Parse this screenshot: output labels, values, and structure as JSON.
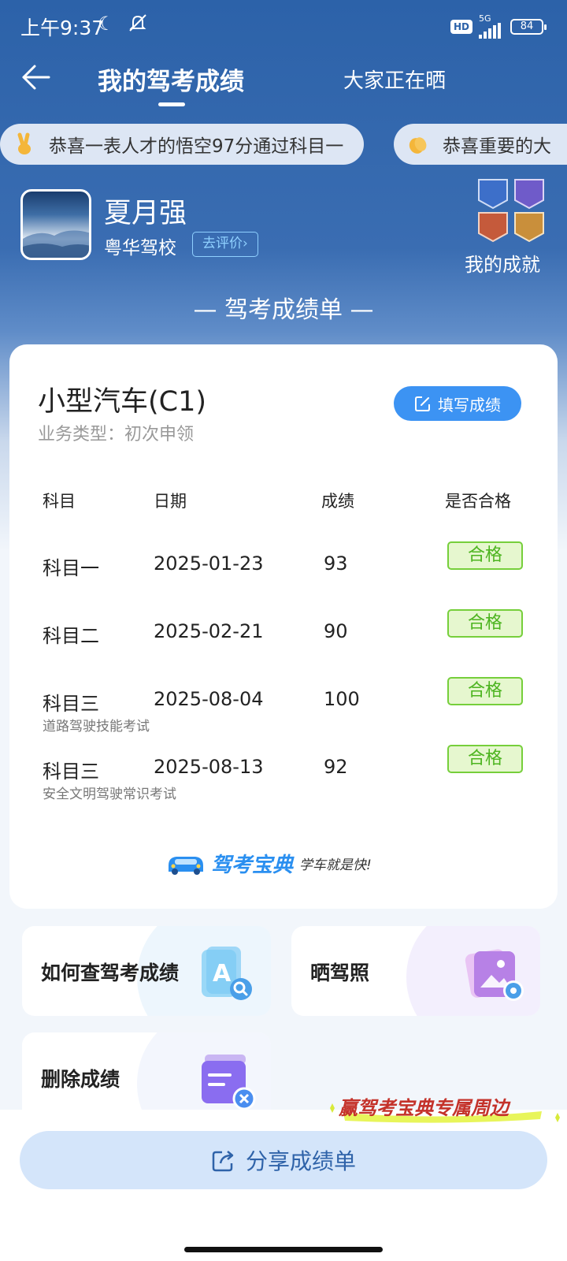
{
  "status_bar": {
    "time": "上午9:37",
    "hd": "HD",
    "network": "5G",
    "battery": "84"
  },
  "nav": {
    "tab_active": "我的驾考成绩",
    "tab_other": "大家正在晒"
  },
  "ticker": [
    {
      "emoji": "victory-hand",
      "text": "恭喜一表人才的悟空97分通过科目一"
    },
    {
      "emoji": "clapping-hands",
      "text": "恭喜重要的大"
    }
  ],
  "profile": {
    "name": "夏月强",
    "school": "粤华驾校",
    "review_label": "去评价",
    "achievements_label": "我的成就"
  },
  "sheet_title": "— 驾考成绩单 —",
  "card": {
    "car_type": "小型汽车(C1)",
    "business_type": "业务类型：初次申领",
    "fill_button": "填写成绩",
    "headers": {
      "subject": "科目",
      "date": "日期",
      "score": "成绩",
      "pass": "是否合格"
    },
    "rows": [
      {
        "subject": "科目一",
        "sub": "",
        "date": "2025-01-23",
        "score": "93",
        "result": "合格"
      },
      {
        "subject": "科目二",
        "sub": "",
        "date": "2025-02-21",
        "score": "90",
        "result": "合格"
      },
      {
        "subject": "科目三",
        "sub": "道路驾驶技能考试",
        "date": "2025-08-04",
        "score": "100",
        "result": "合格"
      },
      {
        "subject": "科目三",
        "sub": "安全文明驾驶常识考试",
        "date": "2025-08-13",
        "score": "92",
        "result": "合格"
      }
    ],
    "brand_name": "驾考宝典",
    "brand_slogan": "学车就是快!"
  },
  "tiles": {
    "query": "如何查驾考成绩",
    "license": "晒驾照",
    "delete": "删除成绩"
  },
  "promo": "赢驾考宝典专属周边",
  "share_button": "分享成绩单",
  "colors": {
    "header_blue": "#2c62a9",
    "accent_blue": "#3c93f3",
    "pass_green": "#4cb41f",
    "share_bg": "#d4e5fa"
  }
}
